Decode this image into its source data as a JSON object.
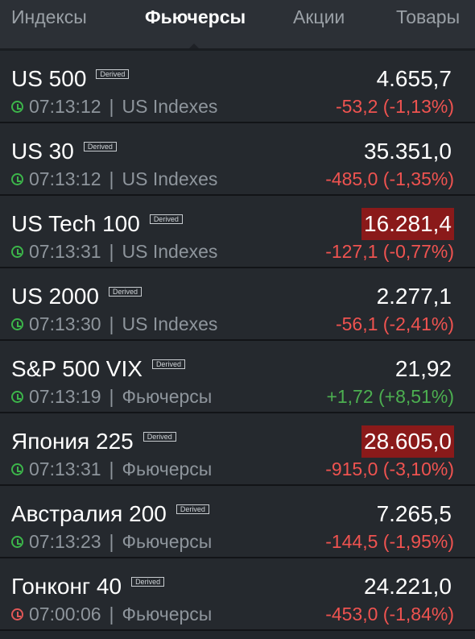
{
  "tabs": [
    {
      "label": "Индексы",
      "active": false
    },
    {
      "label": "Фьючерсы",
      "active": true
    },
    {
      "label": "Акции",
      "active": false
    },
    {
      "label": "Товары",
      "active": false
    }
  ],
  "badge_label": "Derived",
  "rows": [
    {
      "name": "US 500",
      "time": "07:13:12",
      "category": "US Indexes",
      "price": "4.655,7",
      "change": "-53,2 (-1,13%)",
      "direction": "down",
      "highlight": false
    },
    {
      "name": "US 30",
      "time": "07:13:12",
      "category": "US Indexes",
      "price": "35.351,0",
      "change": "-485,0 (-1,35%)",
      "direction": "down",
      "highlight": false
    },
    {
      "name": "US Tech 100",
      "time": "07:13:31",
      "category": "US Indexes",
      "price": "16.281,4",
      "change": "-127,1 (-0,77%)",
      "direction": "down",
      "highlight": true
    },
    {
      "name": "US 2000",
      "time": "07:13:30",
      "category": "US Indexes",
      "price": "2.277,1",
      "change": "-56,1 (-2,41%)",
      "direction": "down",
      "highlight": false
    },
    {
      "name": "S&P 500 VIX",
      "time": "07:13:19",
      "category": "Фьючерсы",
      "price": "21,92",
      "change": "+1,72 (+8,51%)",
      "direction": "up",
      "highlight": false
    },
    {
      "name": "Япония 225",
      "time": "07:13:31",
      "category": "Фьючерсы",
      "price": "28.605,0",
      "change": "-915,0 (-3,10%)",
      "direction": "down",
      "highlight": true
    },
    {
      "name": "Австралия 200",
      "time": "07:13:23",
      "category": "Фьючерсы",
      "price": "7.265,5",
      "change": "-144,5 (-1,95%)",
      "direction": "down",
      "highlight": false
    },
    {
      "name": "Гонконг 40",
      "time": "07:00:06",
      "category": "Фьючерсы",
      "price": "24.221,0",
      "change": "-453,0 (-1,84%)",
      "direction": "down",
      "highlight": false,
      "clock_status": "closed"
    }
  ],
  "colors": {
    "background": "#25292e",
    "down": "#ef5350",
    "up": "#4caf50",
    "highlight": "#8a1a1a",
    "clock_open": "#3cb54a",
    "clock_closed": "#e05757"
  }
}
